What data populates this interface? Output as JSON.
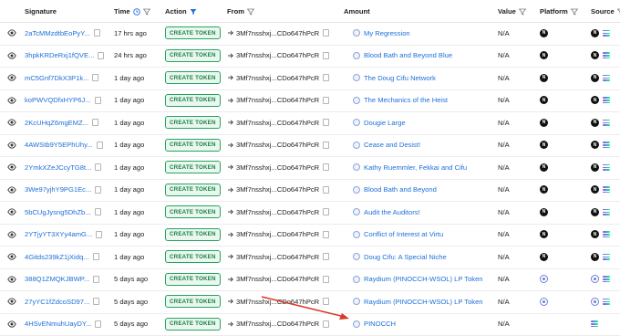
{
  "columns": {
    "signature": "Signature",
    "time": "Time",
    "action": "Action",
    "from": "From",
    "amount": "Amount",
    "value": "Value",
    "platform": "Platform",
    "source": "Source"
  },
  "rows": [
    {
      "signature": "2aTcMMzdtbEoPyY...",
      "time": "17 hrs ago",
      "action": "CREATE TOKEN",
      "from": "3Mf7nsshxj...CDo647hPcR",
      "amount": "My Regression",
      "value": "N/A",
      "platform": "pump",
      "source": "pump-solana"
    },
    {
      "signature": "3hpkKRDeRxj1fQVE...",
      "time": "24 hrs ago",
      "action": "CREATE TOKEN",
      "from": "3Mf7nsshxj...CDo647hPcR",
      "amount": "Blood Bath and Beyond Blue",
      "value": "N/A",
      "platform": "pump",
      "source": "pump-solana"
    },
    {
      "signature": "mC5Gnf7DkX3P1k...",
      "time": "1 day ago",
      "action": "CREATE TOKEN",
      "from": "3Mf7nsshxj...CDo647hPcR",
      "amount": "The Doug Cifu Network",
      "value": "N/A",
      "platform": "pump",
      "source": "pump-solana"
    },
    {
      "signature": "koPWVQDfxHYP6J...",
      "time": "1 day ago",
      "action": "CREATE TOKEN",
      "from": "3Mf7nsshxj...CDo647hPcR",
      "amount": "The Mechanics of the Heist",
      "value": "N/A",
      "platform": "pump",
      "source": "pump-solana"
    },
    {
      "signature": "2KcUHqZ6mgEMZ...",
      "time": "1 day ago",
      "action": "CREATE TOKEN",
      "from": "3Mf7nsshxj...CDo647hPcR",
      "amount": "Dougie Large",
      "value": "N/A",
      "platform": "pump",
      "source": "pump-solana"
    },
    {
      "signature": "4AWStb9Y5EPhUhy...",
      "time": "1 day ago",
      "action": "CREATE TOKEN",
      "from": "3Mf7nsshxj...CDo647hPcR",
      "amount": "Cease and Desist!",
      "value": "N/A",
      "platform": "pump",
      "source": "pump-solana"
    },
    {
      "signature": "2YmkXZeJCcyTG8t...",
      "time": "1 day ago",
      "action": "CREATE TOKEN",
      "from": "3Mf7nsshxj...CDo647hPcR",
      "amount": "Kathy Ruemmler, Fekkai and Cifu",
      "value": "N/A",
      "platform": "pump",
      "source": "pump-solana"
    },
    {
      "signature": "3We97yjhY9PG1Ec...",
      "time": "1 day ago",
      "action": "CREATE TOKEN",
      "from": "3Mf7nsshxj...CDo647hPcR",
      "amount": "Blood Bath and Beyond",
      "value": "N/A",
      "platform": "pump",
      "source": "pump-solana"
    },
    {
      "signature": "5bCUgJysng5DhZb...",
      "time": "1 day ago",
      "action": "CREATE TOKEN",
      "from": "3Mf7nsshxj...CDo647hPcR",
      "amount": "Audit the Auditors!",
      "value": "N/A",
      "platform": "pump",
      "source": "pump-solana"
    },
    {
      "signature": "2YTjyYT3XYy4amG...",
      "time": "1 day ago",
      "action": "CREATE TOKEN",
      "from": "3Mf7nsshxj...CDo647hPcR",
      "amount": "Conflict of Interest at Virtu",
      "value": "N/A",
      "platform": "pump",
      "source": "pump-solana"
    },
    {
      "signature": "4Gitds239kZ1jXidq...",
      "time": "1 day ago",
      "action": "CREATE TOKEN",
      "from": "3Mf7nsshxj...CDo647hPcR",
      "amount": "Doug Cifu: A Special Niche",
      "value": "N/A",
      "platform": "pump",
      "source": "pump-solana"
    },
    {
      "signature": "388Q1ZMQKJBWP...",
      "time": "5 days ago",
      "action": "CREATE TOKEN",
      "from": "3Mf7nsshxj...CDo647hPcR",
      "amount": "Raydium (PINOCCH-WSOL) LP Token",
      "value": "N/A",
      "platform": "raydium",
      "source": "raydium-solana"
    },
    {
      "signature": "27yYC1fZdcoSD97...",
      "time": "5 days ago",
      "action": "CREATE TOKEN",
      "from": "3Mf7nsshxj...CDo647hPcR",
      "amount": "Raydium (PINOCCH-WSOL) LP Token",
      "value": "N/A",
      "platform": "raydium",
      "source": "raydium-solana"
    },
    {
      "signature": "4HSvENmuhUayDY...",
      "time": "5 days ago",
      "action": "CREATE TOKEN",
      "from": "3Mf7nsshxj...CDo647hPcR",
      "amount": "PINOCCH",
      "value": "N/A",
      "platform": "none",
      "source": "solana"
    }
  ],
  "colors": {
    "annotation_arrow": "#d93a2b",
    "link": "#1e6fd9",
    "badge_green": "#25a55f"
  }
}
